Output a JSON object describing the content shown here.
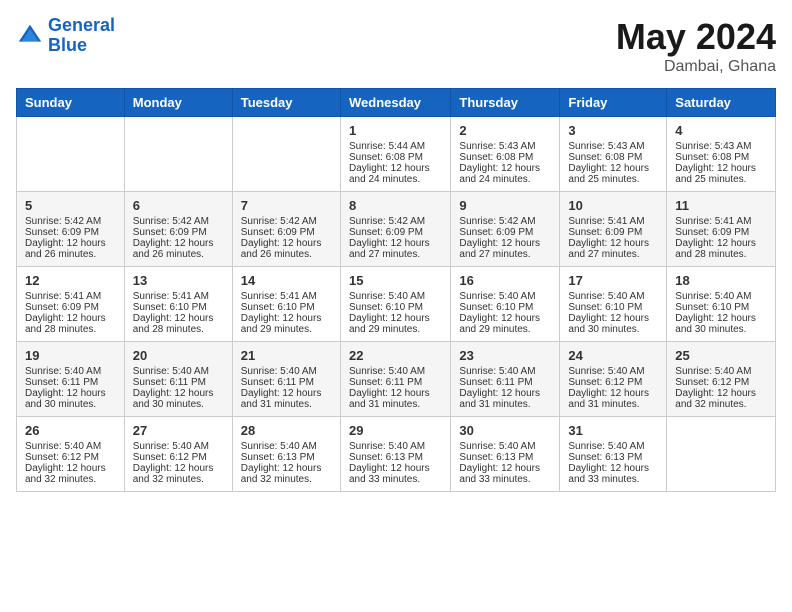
{
  "header": {
    "logo_line1": "General",
    "logo_line2": "Blue",
    "month": "May 2024",
    "location": "Dambai, Ghana"
  },
  "days_of_week": [
    "Sunday",
    "Monday",
    "Tuesday",
    "Wednesday",
    "Thursday",
    "Friday",
    "Saturday"
  ],
  "weeks": [
    [
      {
        "day": "",
        "sunrise": "",
        "sunset": "",
        "daylight": ""
      },
      {
        "day": "",
        "sunrise": "",
        "sunset": "",
        "daylight": ""
      },
      {
        "day": "",
        "sunrise": "",
        "sunset": "",
        "daylight": ""
      },
      {
        "day": "1",
        "sunrise": "Sunrise: 5:44 AM",
        "sunset": "Sunset: 6:08 PM",
        "daylight": "Daylight: 12 hours and 24 minutes."
      },
      {
        "day": "2",
        "sunrise": "Sunrise: 5:43 AM",
        "sunset": "Sunset: 6:08 PM",
        "daylight": "Daylight: 12 hours and 24 minutes."
      },
      {
        "day": "3",
        "sunrise": "Sunrise: 5:43 AM",
        "sunset": "Sunset: 6:08 PM",
        "daylight": "Daylight: 12 hours and 25 minutes."
      },
      {
        "day": "4",
        "sunrise": "Sunrise: 5:43 AM",
        "sunset": "Sunset: 6:08 PM",
        "daylight": "Daylight: 12 hours and 25 minutes."
      }
    ],
    [
      {
        "day": "5",
        "sunrise": "Sunrise: 5:42 AM",
        "sunset": "Sunset: 6:09 PM",
        "daylight": "Daylight: 12 hours and 26 minutes."
      },
      {
        "day": "6",
        "sunrise": "Sunrise: 5:42 AM",
        "sunset": "Sunset: 6:09 PM",
        "daylight": "Daylight: 12 hours and 26 minutes."
      },
      {
        "day": "7",
        "sunrise": "Sunrise: 5:42 AM",
        "sunset": "Sunset: 6:09 PM",
        "daylight": "Daylight: 12 hours and 26 minutes."
      },
      {
        "day": "8",
        "sunrise": "Sunrise: 5:42 AM",
        "sunset": "Sunset: 6:09 PM",
        "daylight": "Daylight: 12 hours and 27 minutes."
      },
      {
        "day": "9",
        "sunrise": "Sunrise: 5:42 AM",
        "sunset": "Sunset: 6:09 PM",
        "daylight": "Daylight: 12 hours and 27 minutes."
      },
      {
        "day": "10",
        "sunrise": "Sunrise: 5:41 AM",
        "sunset": "Sunset: 6:09 PM",
        "daylight": "Daylight: 12 hours and 27 minutes."
      },
      {
        "day": "11",
        "sunrise": "Sunrise: 5:41 AM",
        "sunset": "Sunset: 6:09 PM",
        "daylight": "Daylight: 12 hours and 28 minutes."
      }
    ],
    [
      {
        "day": "12",
        "sunrise": "Sunrise: 5:41 AM",
        "sunset": "Sunset: 6:09 PM",
        "daylight": "Daylight: 12 hours and 28 minutes."
      },
      {
        "day": "13",
        "sunrise": "Sunrise: 5:41 AM",
        "sunset": "Sunset: 6:10 PM",
        "daylight": "Daylight: 12 hours and 28 minutes."
      },
      {
        "day": "14",
        "sunrise": "Sunrise: 5:41 AM",
        "sunset": "Sunset: 6:10 PM",
        "daylight": "Daylight: 12 hours and 29 minutes."
      },
      {
        "day": "15",
        "sunrise": "Sunrise: 5:40 AM",
        "sunset": "Sunset: 6:10 PM",
        "daylight": "Daylight: 12 hours and 29 minutes."
      },
      {
        "day": "16",
        "sunrise": "Sunrise: 5:40 AM",
        "sunset": "Sunset: 6:10 PM",
        "daylight": "Daylight: 12 hours and 29 minutes."
      },
      {
        "day": "17",
        "sunrise": "Sunrise: 5:40 AM",
        "sunset": "Sunset: 6:10 PM",
        "daylight": "Daylight: 12 hours and 30 minutes."
      },
      {
        "day": "18",
        "sunrise": "Sunrise: 5:40 AM",
        "sunset": "Sunset: 6:10 PM",
        "daylight": "Daylight: 12 hours and 30 minutes."
      }
    ],
    [
      {
        "day": "19",
        "sunrise": "Sunrise: 5:40 AM",
        "sunset": "Sunset: 6:11 PM",
        "daylight": "Daylight: 12 hours and 30 minutes."
      },
      {
        "day": "20",
        "sunrise": "Sunrise: 5:40 AM",
        "sunset": "Sunset: 6:11 PM",
        "daylight": "Daylight: 12 hours and 30 minutes."
      },
      {
        "day": "21",
        "sunrise": "Sunrise: 5:40 AM",
        "sunset": "Sunset: 6:11 PM",
        "daylight": "Daylight: 12 hours and 31 minutes."
      },
      {
        "day": "22",
        "sunrise": "Sunrise: 5:40 AM",
        "sunset": "Sunset: 6:11 PM",
        "daylight": "Daylight: 12 hours and 31 minutes."
      },
      {
        "day": "23",
        "sunrise": "Sunrise: 5:40 AM",
        "sunset": "Sunset: 6:11 PM",
        "daylight": "Daylight: 12 hours and 31 minutes."
      },
      {
        "day": "24",
        "sunrise": "Sunrise: 5:40 AM",
        "sunset": "Sunset: 6:12 PM",
        "daylight": "Daylight: 12 hours and 31 minutes."
      },
      {
        "day": "25",
        "sunrise": "Sunrise: 5:40 AM",
        "sunset": "Sunset: 6:12 PM",
        "daylight": "Daylight: 12 hours and 32 minutes."
      }
    ],
    [
      {
        "day": "26",
        "sunrise": "Sunrise: 5:40 AM",
        "sunset": "Sunset: 6:12 PM",
        "daylight": "Daylight: 12 hours and 32 minutes."
      },
      {
        "day": "27",
        "sunrise": "Sunrise: 5:40 AM",
        "sunset": "Sunset: 6:12 PM",
        "daylight": "Daylight: 12 hours and 32 minutes."
      },
      {
        "day": "28",
        "sunrise": "Sunrise: 5:40 AM",
        "sunset": "Sunset: 6:13 PM",
        "daylight": "Daylight: 12 hours and 32 minutes."
      },
      {
        "day": "29",
        "sunrise": "Sunrise: 5:40 AM",
        "sunset": "Sunset: 6:13 PM",
        "daylight": "Daylight: 12 hours and 33 minutes."
      },
      {
        "day": "30",
        "sunrise": "Sunrise: 5:40 AM",
        "sunset": "Sunset: 6:13 PM",
        "daylight": "Daylight: 12 hours and 33 minutes."
      },
      {
        "day": "31",
        "sunrise": "Sunrise: 5:40 AM",
        "sunset": "Sunset: 6:13 PM",
        "daylight": "Daylight: 12 hours and 33 minutes."
      },
      {
        "day": "",
        "sunrise": "",
        "sunset": "",
        "daylight": ""
      }
    ]
  ]
}
